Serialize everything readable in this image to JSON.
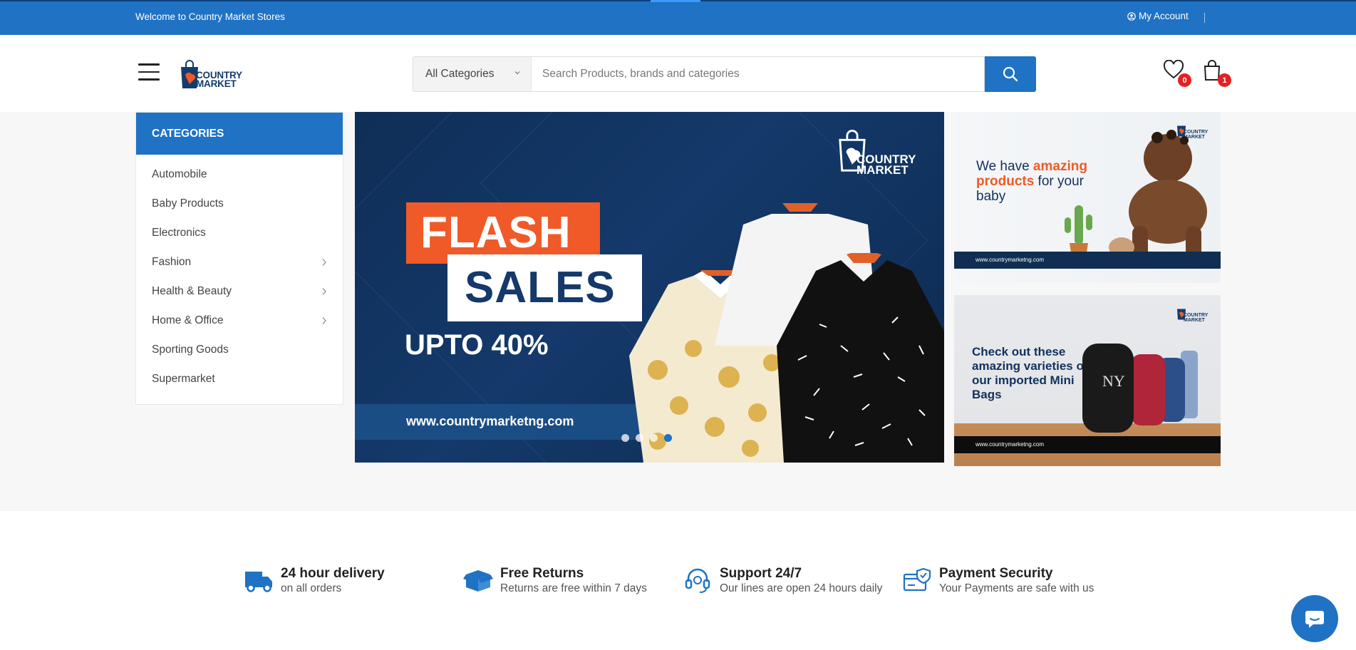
{
  "topbar": {
    "welcome": "Welcome to Country Market Stores",
    "account_label": "My Account"
  },
  "header": {
    "logo_line1": "COUNTRY",
    "logo_line2": "MARKET",
    "search": {
      "category_selected": "All Categories",
      "placeholder": "Search Products, brands and categories"
    },
    "wishlist_count": "0",
    "cart_count": "1"
  },
  "categories": {
    "title": "CATEGORIES",
    "items": [
      {
        "label": "Automobile",
        "has_children": false
      },
      {
        "label": "Baby Products",
        "has_children": false
      },
      {
        "label": "Electronics",
        "has_children": false
      },
      {
        "label": "Fashion",
        "has_children": true
      },
      {
        "label": "Health & Beauty",
        "has_children": true
      },
      {
        "label": "Home & Office",
        "has_children": true
      },
      {
        "label": "Sporting Goods",
        "has_children": false
      },
      {
        "label": "Supermarket",
        "has_children": false
      }
    ]
  },
  "hero": {
    "logo_line1": "COUNTRY",
    "logo_line2": "MARKET",
    "flash": "FLASH",
    "sales": "SALES",
    "discount": "UPTO 40%",
    "url": "www.countrymarketng.com",
    "slide_count": 4,
    "active_slide": 4
  },
  "banners": {
    "baby": {
      "line1": "We have ",
      "highlight": "amazing products",
      "line2": " for your baby",
      "url": "www.countrymarketng.com",
      "logo_line1": "COUNTRY",
      "logo_line2": "MARKET"
    },
    "bags": {
      "copy": "Check out these amazing varieties of our imported Mini Bags",
      "url": "www.countrymarketng.com",
      "logo_line1": "COUNTRY",
      "logo_line2": "MARKET"
    }
  },
  "features": [
    {
      "title": "24 hour delivery",
      "subtitle": "on all orders",
      "icon": "truck-icon"
    },
    {
      "title": "Free Returns",
      "subtitle": "Returns are free within 7 days",
      "icon": "box-icon"
    },
    {
      "title": "Support 24/7",
      "subtitle": "Our lines are open 24 hours daily",
      "icon": "headset-icon"
    },
    {
      "title": "Payment Security",
      "subtitle": "Your Payments are safe with us",
      "icon": "secure-card-icon"
    }
  ],
  "colors": {
    "primary_blue": "#1f72c4",
    "navy": "#14396a",
    "orange": "#ef5a28",
    "badge_red": "#e52020"
  }
}
